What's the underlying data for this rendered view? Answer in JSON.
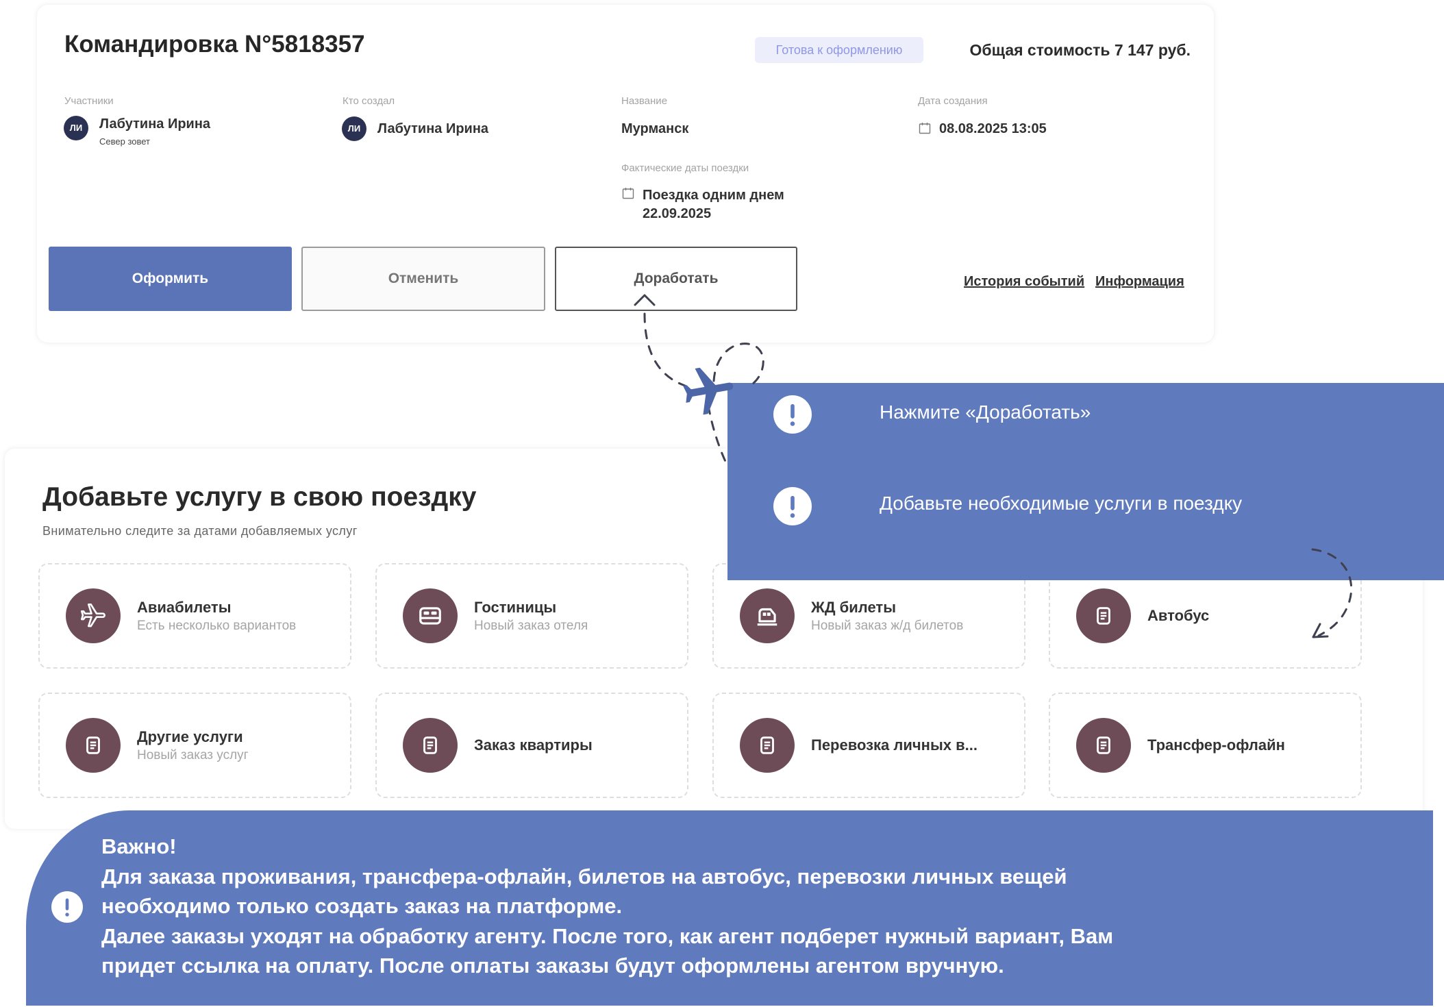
{
  "trip_card": {
    "title": "Командировка N°5818357",
    "status_badge": "Готова к оформлению",
    "total_cost": "Общая стоимость 7 147 руб.",
    "fields": {
      "participants": {
        "label": "Участники",
        "avatar_initials": "ЛИ",
        "name": "Лабутина Ирина",
        "subtitle": "Север зовет"
      },
      "creator": {
        "label": "Кто создал",
        "avatar_initials": "ЛИ",
        "name": "Лабутина Ирина"
      },
      "trip_name": {
        "label": "Название",
        "value": "Мурманск"
      },
      "actual_dates": {
        "label": "Фактические даты поездки",
        "line1": "Поездка одним днем",
        "line2": "22.09.2025",
        "icon": "calendar-icon"
      },
      "created_date": {
        "label": "Дата создания",
        "value": "08.08.2025 13:05",
        "icon": "calendar-icon"
      }
    },
    "buttons": {
      "submit": "Оформить",
      "cancel": "Отменить",
      "revise": "Доработать"
    },
    "links": {
      "history": "История событий",
      "info": "Информация"
    }
  },
  "callout": {
    "icon": "exclamation-icon",
    "steps": [
      "Нажмите «Доработать»",
      "Добавьте необходимые услуги в поездку"
    ]
  },
  "services": {
    "title": "Добавьте услугу в свою поездку",
    "subtitle": "Внимательно следите за датами добавляемых услуг",
    "items": [
      {
        "title": "Авиабилеты",
        "subtitle": "Есть несколько вариантов",
        "icon": "plane-icon"
      },
      {
        "title": "Гостиницы",
        "subtitle": "Новый заказ отеля",
        "icon": "bed-icon"
      },
      {
        "title": "ЖД билеты",
        "subtitle": "Новый заказ ж/д билетов",
        "icon": "train-icon"
      },
      {
        "title": "Автобус",
        "icon": "document-icon"
      },
      {
        "title": "Другие услуги",
        "subtitle": "Новый заказ услуг",
        "icon": "document-icon"
      },
      {
        "title": "Заказ квартиры",
        "icon": "document-icon"
      },
      {
        "title": "Перевозка личных в...",
        "icon": "document-icon"
      },
      {
        "title": "Трансфер-офлайн",
        "icon": "document-icon"
      }
    ]
  },
  "note": {
    "icon": "exclamation-icon",
    "title": "Важно!",
    "lines": [
      "Для заказа проживания, трансфера-офлайн, билетов на автобус, перевозки личных вещей",
      "необходимо только создать заказ на платформе.",
      "Далее заказы уходят на обработку агенту. После того, как агент подберет нужный вариант, Вам",
      "придет ссылка на оплату. После оплаты заказы будут оформлены агентом вручную."
    ]
  },
  "colors": {
    "primary_button": "#5b73b7",
    "callout_bg": "#5f7abd",
    "service_icon_bg": "#6e4c57",
    "avatar_bg": "#2b3152",
    "badge_bg": "#eceefc",
    "badge_text": "#8f97e6",
    "plane": "#4d66a8"
  }
}
